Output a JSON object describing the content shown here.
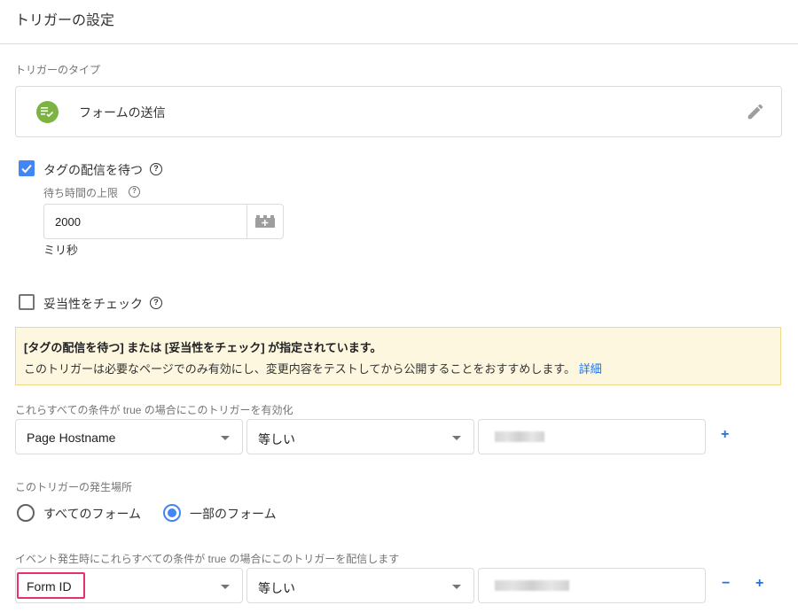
{
  "header": {
    "title": "トリガーの設定"
  },
  "trigger_type": {
    "label": "トリガーのタイプ",
    "name": "フォームの送信",
    "icon": "form-submit-icon",
    "icon_color": "#7cb342"
  },
  "wait_for_tags": {
    "label": "タグの配信を待つ",
    "checked": true,
    "timeout_label": "待ち時間の上限",
    "timeout_value": "2000",
    "unit": "ミリ秒"
  },
  "check_validation": {
    "label": "妥当性をチェック",
    "checked": false
  },
  "notice": {
    "title": "[タグの配信を待つ] または [妥当性をチェック] が指定されています。",
    "body": "このトリガーは必要なページでのみ有効にし、変更内容をテストしてから公開することをおすすめします。",
    "link": "詳細"
  },
  "enable_conditions": {
    "label": "これらすべての条件が true の場合にこのトリガーを有効化",
    "variable": "Page Hostname",
    "operator": "等しい",
    "value": "",
    "add": "+"
  },
  "fire_on": {
    "label": "このトリガーの発生場所",
    "options": [
      {
        "label": "すべてのフォーム",
        "selected": false
      },
      {
        "label": "一部のフォーム",
        "selected": true
      }
    ]
  },
  "fire_conditions": {
    "label": "イベント発生時にこれらすべての条件が true の場合にこのトリガーを配信します",
    "variable": "Form ID",
    "operator": "等しい",
    "value": "",
    "remove": "−",
    "add": "+"
  },
  "colors": {
    "accent": "#4285f4",
    "link": "#1a73e8",
    "highlight": "#e8306f",
    "notice_bg": "#fef7e0"
  }
}
